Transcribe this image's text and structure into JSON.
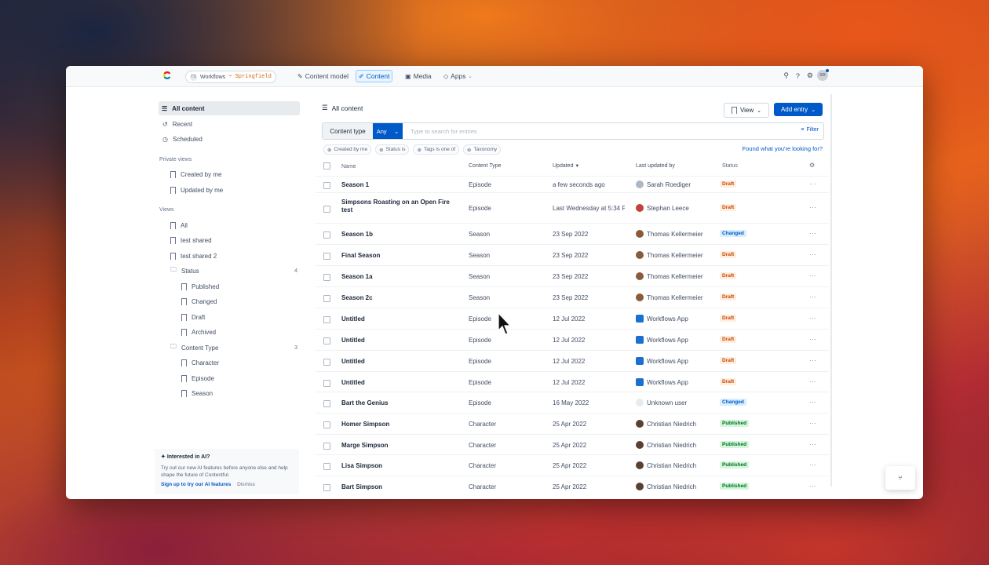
{
  "nav": {
    "env_avatar": "TS",
    "space": "Workflows",
    "branch": "Springfield",
    "items": [
      {
        "label": "Content model",
        "icon": "pencil-icon"
      },
      {
        "label": "Content",
        "icon": "edit-icon",
        "active": true
      },
      {
        "label": "Media",
        "icon": "image-icon"
      },
      {
        "label": "Apps",
        "icon": "apps-icon"
      }
    ],
    "user_initials": "SR"
  },
  "sidebar": {
    "all_content": "All content",
    "recent": "Recent",
    "scheduled": "Scheduled",
    "private_views_label": "Private views",
    "created_by_me": "Created by me",
    "updated_by_me": "Updated by me",
    "views_label": "Views",
    "all": "All",
    "test_shared": "test shared",
    "test_shared_2": "test shared 2",
    "status": "Status",
    "status_count": "4",
    "published": "Published",
    "changed": "Changed",
    "draft": "Draft",
    "archived": "Archived",
    "content_type": "Content Type",
    "content_type_count": "3",
    "character": "Character",
    "episode": "Episode",
    "season": "Season"
  },
  "ai_promo": {
    "title": "Interested in AI?",
    "body": "Try out our new AI features before anyone else and help shape the future of Contentful.",
    "link": "Sign up to try our AI features",
    "dismiss": "Dismiss"
  },
  "main": {
    "title": "All content",
    "view_label": "View",
    "add_entry": "Add entry",
    "content_type_label": "Content type",
    "any_label": "Any",
    "search_placeholder": "Type to search for entries",
    "filter_label": "Filter",
    "chips": [
      "Created by me",
      "Status is",
      "Tags is one of",
      "Taxonomy"
    ],
    "found_link": "Found what you're looking for?"
  },
  "table": {
    "headers": {
      "name": "Name",
      "type": "Content Type",
      "updated": "Updated",
      "by": "Last updated by",
      "status": "Status"
    },
    "rows": [
      {
        "name": "Season 1",
        "type": "Episode",
        "updated": "a few seconds ago",
        "by": "Sarah Roediger",
        "status": "Draft"
      },
      {
        "name": "Simpsons Roasting on an Open Fire test",
        "type": "Episode",
        "updated": "Last Wednesday at 5:34 PM",
        "by": "Stephan Leece",
        "status": "Draft"
      },
      {
        "name": "Season 1b",
        "type": "Season",
        "updated": "23 Sep 2022",
        "by": "Thomas Kellermeier",
        "status": "Changed"
      },
      {
        "name": "Final Season",
        "type": "Season",
        "updated": "23 Sep 2022",
        "by": "Thomas Kellermeier",
        "status": "Draft"
      },
      {
        "name": "Season 1a",
        "type": "Season",
        "updated": "23 Sep 2022",
        "by": "Thomas Kellermeier",
        "status": "Draft"
      },
      {
        "name": "Season 2c",
        "type": "Season",
        "updated": "23 Sep 2022",
        "by": "Thomas Kellermeier",
        "status": "Draft"
      },
      {
        "name": "Untitled",
        "type": "Episode",
        "updated": "12 Jul 2022",
        "by": "Workflows App",
        "status": "Draft"
      },
      {
        "name": "Untitled",
        "type": "Episode",
        "updated": "12 Jul 2022",
        "by": "Workflows App",
        "status": "Draft"
      },
      {
        "name": "Untitled",
        "type": "Episode",
        "updated": "12 Jul 2022",
        "by": "Workflows App",
        "status": "Draft"
      },
      {
        "name": "Untitled",
        "type": "Episode",
        "updated": "12 Jul 2022",
        "by": "Workflows App",
        "status": "Draft"
      },
      {
        "name": "Bart the Genius",
        "type": "Episode",
        "updated": "16 May 2022",
        "by": "Unknown user",
        "status": "Changed"
      },
      {
        "name": "Homer Simpson",
        "type": "Character",
        "updated": "25 Apr 2022",
        "by": "Christian Niedrich",
        "status": "Published"
      },
      {
        "name": "Marge Simpson",
        "type": "Character",
        "updated": "25 Apr 2022",
        "by": "Christian Niedrich",
        "status": "Published"
      },
      {
        "name": "Lisa Simpson",
        "type": "Character",
        "updated": "25 Apr 2022",
        "by": "Christian Niedrich",
        "status": "Published"
      },
      {
        "name": "Bart Simpson",
        "type": "Character",
        "updated": "25 Apr 2022",
        "by": "Christian Niedrich",
        "status": "Published"
      }
    ]
  },
  "colors": {
    "accent": "#0059c8",
    "draft_bg": "#fdeee0",
    "draft_fg": "#cc4500",
    "changed_bg": "#d8eeff",
    "changed_fg": "#0059c8",
    "published_bg": "#d4f7dc",
    "published_fg": "#006d23"
  }
}
